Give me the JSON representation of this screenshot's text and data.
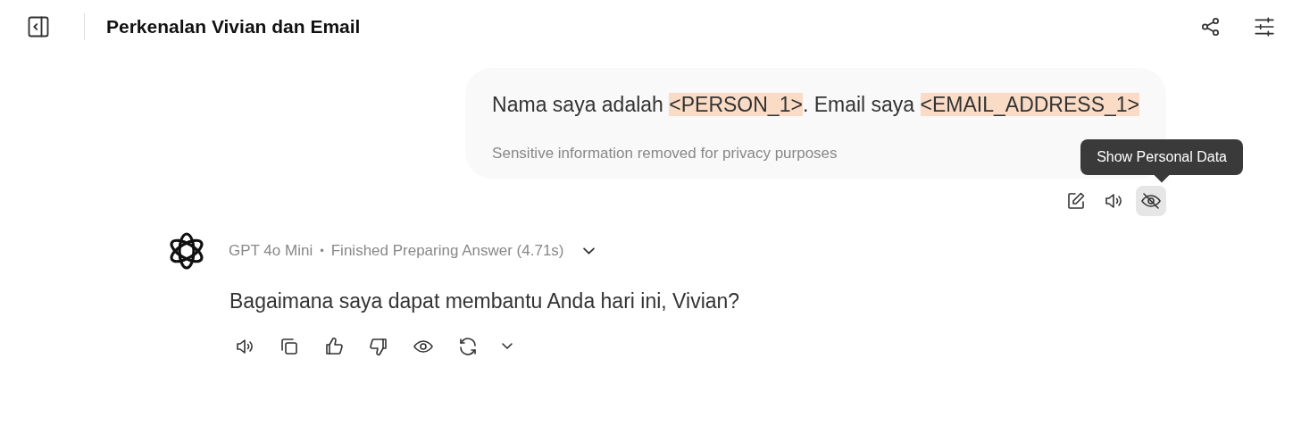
{
  "header": {
    "title": "Perkenalan Vivian dan Email"
  },
  "user_message": {
    "segments": [
      {
        "text": "Nama saya adalah ",
        "redacted": false
      },
      {
        "text": "<PERSON_1>",
        "redacted": true
      },
      {
        "text": ". Email saya ",
        "redacted": false
      },
      {
        "text": "<EMAIL_ADDRESS_1>",
        "redacted": true
      }
    ],
    "note": "Sensitive information removed for privacy purposes",
    "actions": [
      {
        "kind": "edit",
        "active": false
      },
      {
        "kind": "speaker",
        "active": false
      },
      {
        "kind": "hide",
        "active": true
      }
    ],
    "tooltip": "Show Personal Data"
  },
  "assistant_message": {
    "model": "GPT 4o Mini",
    "separator": "•",
    "status": "Finished Preparing Answer (4.71s)",
    "text": "Bagaimana saya dapat membantu Anda hari ini, Vivian?",
    "actions": [
      {
        "kind": "speaker"
      },
      {
        "kind": "copy"
      },
      {
        "kind": "like"
      },
      {
        "kind": "dislike"
      },
      {
        "kind": "show"
      },
      {
        "kind": "regenerate"
      },
      {
        "kind": "more"
      }
    ]
  }
}
